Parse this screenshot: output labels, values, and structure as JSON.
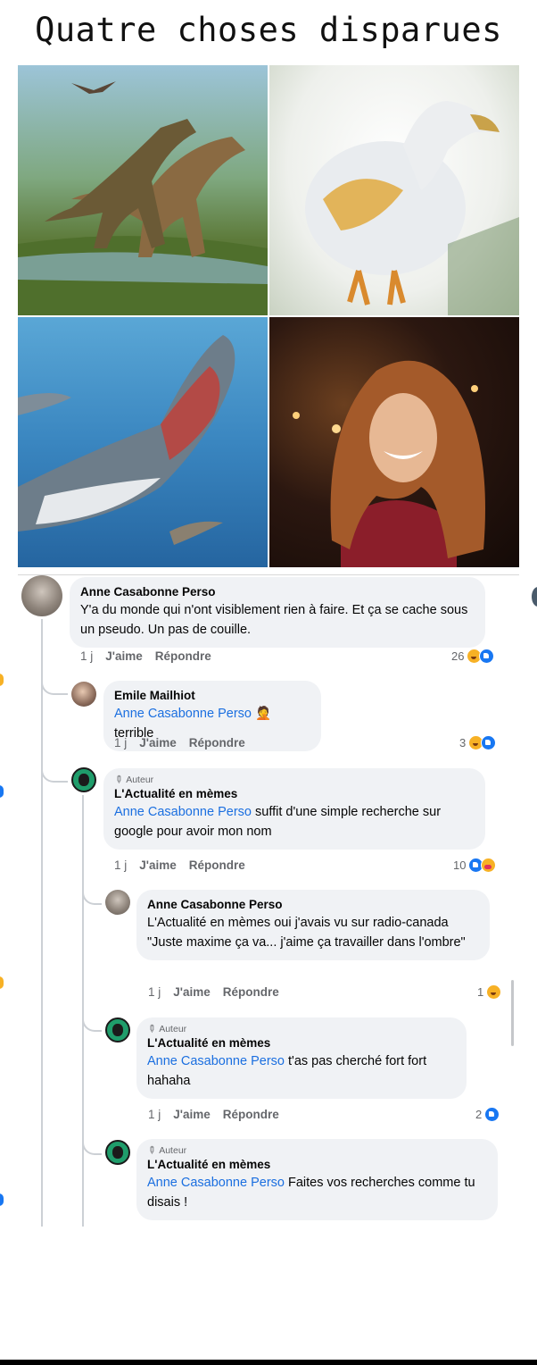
{
  "meme": {
    "title": "Quatre choses disparues"
  },
  "panels": [
    {
      "name": "dinosaurs-image"
    },
    {
      "name": "dodo-image"
    },
    {
      "name": "megalodon-image"
    },
    {
      "name": "woman-portrait-image"
    }
  ],
  "colors": {
    "mention": "#1b6fe0",
    "bubble": "#f0f2f5",
    "meta": "#65676b"
  },
  "comments": [
    {
      "author": "Anne Casabonne Perso",
      "mention": "",
      "text": "Y'a du monde qui n'ont visiblement rien à faire. Et ça se cache sous un pseudo.  Un pas de couille.",
      "time": "1 j",
      "like": "J'aime",
      "reply": "Répondre",
      "reactions": "26"
    },
    {
      "author": "Emile Mailhiot",
      "mention": "Anne Casabonne Perso",
      "emoji": "🤦",
      "text": "terrible",
      "time": "1 j",
      "like": "J'aime",
      "reply": "Répondre",
      "reactions": "3"
    },
    {
      "badge": "Auteur",
      "author": "L'Actualité en mèmes",
      "mention": "Anne Casabonne Perso",
      "text": "suffit d'une simple recherche sur google pour avoir mon nom",
      "time": "1 j",
      "like": "J'aime",
      "reply": "Répondre",
      "reactions": "10"
    },
    {
      "author": "Anne Casabonne Perso",
      "mention": "",
      "text": "L'Actualité en mèmes oui j'avais vu sur radio-canada \"Juste maxime ça va... j'aime ça travailler dans l'ombre\"",
      "time": "1 j",
      "like": "J'aime",
      "reply": "Répondre",
      "reactions": "1"
    },
    {
      "badge": "Auteur",
      "author": "L'Actualité en mèmes",
      "mention": "Anne Casabonne Perso",
      "text": "t'as pas cherché fort fort hahaha",
      "time": "1 j",
      "like": "J'aime",
      "reply": "Répondre",
      "reactions": "2"
    },
    {
      "badge": "Auteur",
      "author": "L'Actualité en mèmes",
      "mention": "Anne Casabonne Perso",
      "text": "Faites vos recherches comme tu disais !"
    }
  ]
}
